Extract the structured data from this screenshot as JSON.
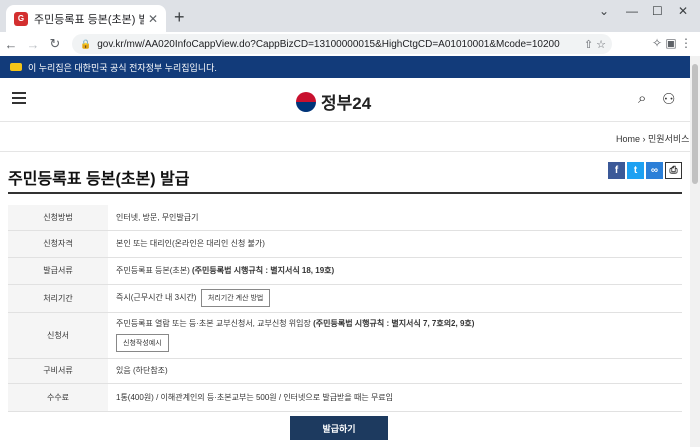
{
  "browser": {
    "tab_title": "주민등록표 등본(초본) 발급 | 민",
    "tab_favicon": "G",
    "new_tab": "+",
    "url": "gov.kr/mw/AA020InfoCappView.do?CappBizCD=13100000015&HighCtgCD=A01010001&Mcode=10200"
  },
  "site": {
    "banner": "이 누리집은 대한민국 공식 전자정부 누리집입니다.",
    "logo": "정부24",
    "breadcrumb": [
      "Home",
      "민원서비스"
    ]
  },
  "page_title": "주민등록표 등본(초본) 발급",
  "share": {
    "fb": "f",
    "tw": "t",
    "link": "∞",
    "print": "⎙"
  },
  "rows": [
    {
      "key": "신청방법",
      "value": "인터넷, 방문, 무인발급기"
    },
    {
      "key": "신청자격",
      "value": "본인 또는 대리인(온라인은 대리인 신청 불가)"
    },
    {
      "key": "발급서류",
      "value": "주민등록표 등본(초본) ",
      "strong": "(주민등록법 시행규칙 : 별지서식 18, 19호)"
    },
    {
      "key": "처리기간",
      "value": "즉시(근무시간 내 3시간)",
      "button": "처리기간 계산 방법"
    },
    {
      "key": "신청서",
      "value": "주민등록표 열람 또는 등·초본 교부신청서, 교부신청 위임장 ",
      "strong": "(주민등록법 시행규칙 : 별지서식 7, 7호의2, 9호)",
      "button": "신청작성예시"
    },
    {
      "key": "구비서류",
      "value": "있음 (하단참조)"
    },
    {
      "key": "수수료",
      "value": "1통(400원) / 이해관계인의 등·초본교부는 500원 / 인터넷으로 발급받을 때는 무료임"
    }
  ],
  "apply_button": "발급하기"
}
